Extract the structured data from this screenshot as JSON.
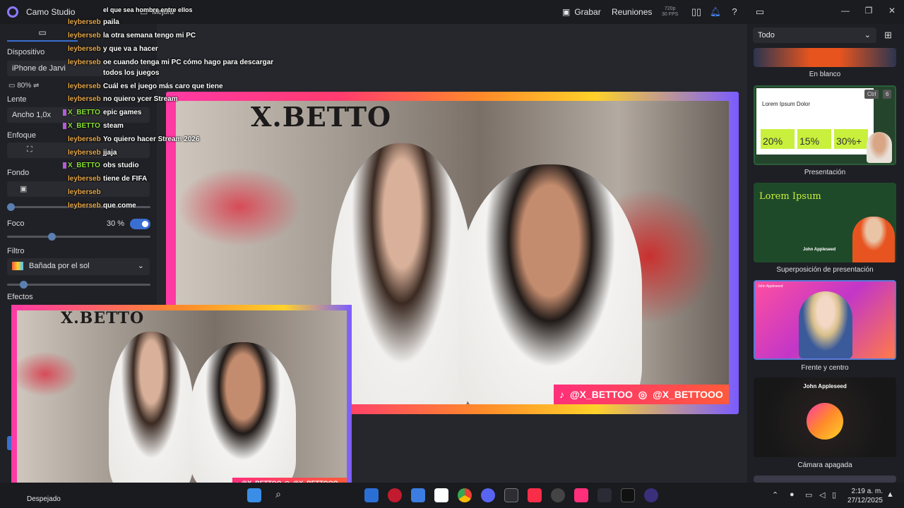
{
  "app": {
    "title": "Camo Studio",
    "mejora": "Mejora"
  },
  "topbar": {
    "record": "Grabar",
    "meetings": "Reuniones",
    "res1": "720p",
    "res2": "30 FPS"
  },
  "left": {
    "device_label": "Dispositivo",
    "device_value": "iPhone de Jarvi",
    "battery": "80%",
    "lens_label": "Lente",
    "lens_value": "Ancho 1,0x",
    "focus_label": "Enfoque",
    "background_label": "Fondo",
    "focus2_label": "Foco",
    "focus2_value": "30 %",
    "filter_label": "Filtro",
    "filter_value": "Bañada por el sol",
    "effects_label": "Efectos"
  },
  "chat": [
    {
      "user": "leyberseb",
      "msg": "paila",
      "green": false
    },
    {
      "user": "leyberseb",
      "msg": "la otra semana tengo mi PC",
      "green": false
    },
    {
      "user": "leyberseb",
      "msg": "y que va a hacer",
      "green": false
    },
    {
      "user": "leyberseb",
      "msg": "oe cuando tenga mi PC cómo hago para descargar",
      "green": false
    },
    {
      "user": "",
      "msg": "todos los juegos",
      "green": false
    },
    {
      "user": "leyberseb",
      "msg": "Cuál es el juego más caro que tiene",
      "green": false
    },
    {
      "user": "leyberseb",
      "msg": "no quiero ycer Stream",
      "green": false
    },
    {
      "user": "X_BETTO",
      "msg": "epic games",
      "green": true
    },
    {
      "user": "X_BETTO",
      "msg": "steam",
      "green": true
    },
    {
      "user": "leyberseb",
      "msg": "Yo quiero hacer Stream 2026",
      "green": false
    },
    {
      "user": "leyberseb",
      "msg": "jjaja",
      "green": false
    },
    {
      "user": "X_BETTO",
      "msg": "obs studio",
      "green": true
    },
    {
      "user": "leyberseb",
      "msg": "tiene de FIFA",
      "green": false
    },
    {
      "user": "leyberseb",
      "msg": "",
      "green": false
    },
    {
      "user": "leyberseb",
      "msg": "que come",
      "green": false
    }
  ],
  "chat_top": "el que sea hombre entre ellos",
  "stream": {
    "logo": "X.BETTO",
    "tiktok": "@X_BETTOO",
    "instagram": "@X_BETTOOO"
  },
  "right": {
    "filter": "Todo",
    "scenes": [
      {
        "label": "En blanco"
      },
      {
        "label": "Presentación"
      },
      {
        "label": "Superposición de presentación"
      },
      {
        "label": "Frente y centro"
      },
      {
        "label": "Cámara apagada"
      }
    ],
    "shortcut_key": "Ctrl",
    "shortcut_num": "6",
    "lorem_dolor": "Lorem Ipsum Dolor",
    "pct1": "20%",
    "pct2": "15%",
    "pct3": "30%+",
    "lorem": "Lorem Ipsum",
    "john": "John Appleseed",
    "john_small": "John Appleseed"
  },
  "taskbar": {
    "weather": "Despejado",
    "time": "2:19 a. m.",
    "date": "27/12/2025"
  }
}
